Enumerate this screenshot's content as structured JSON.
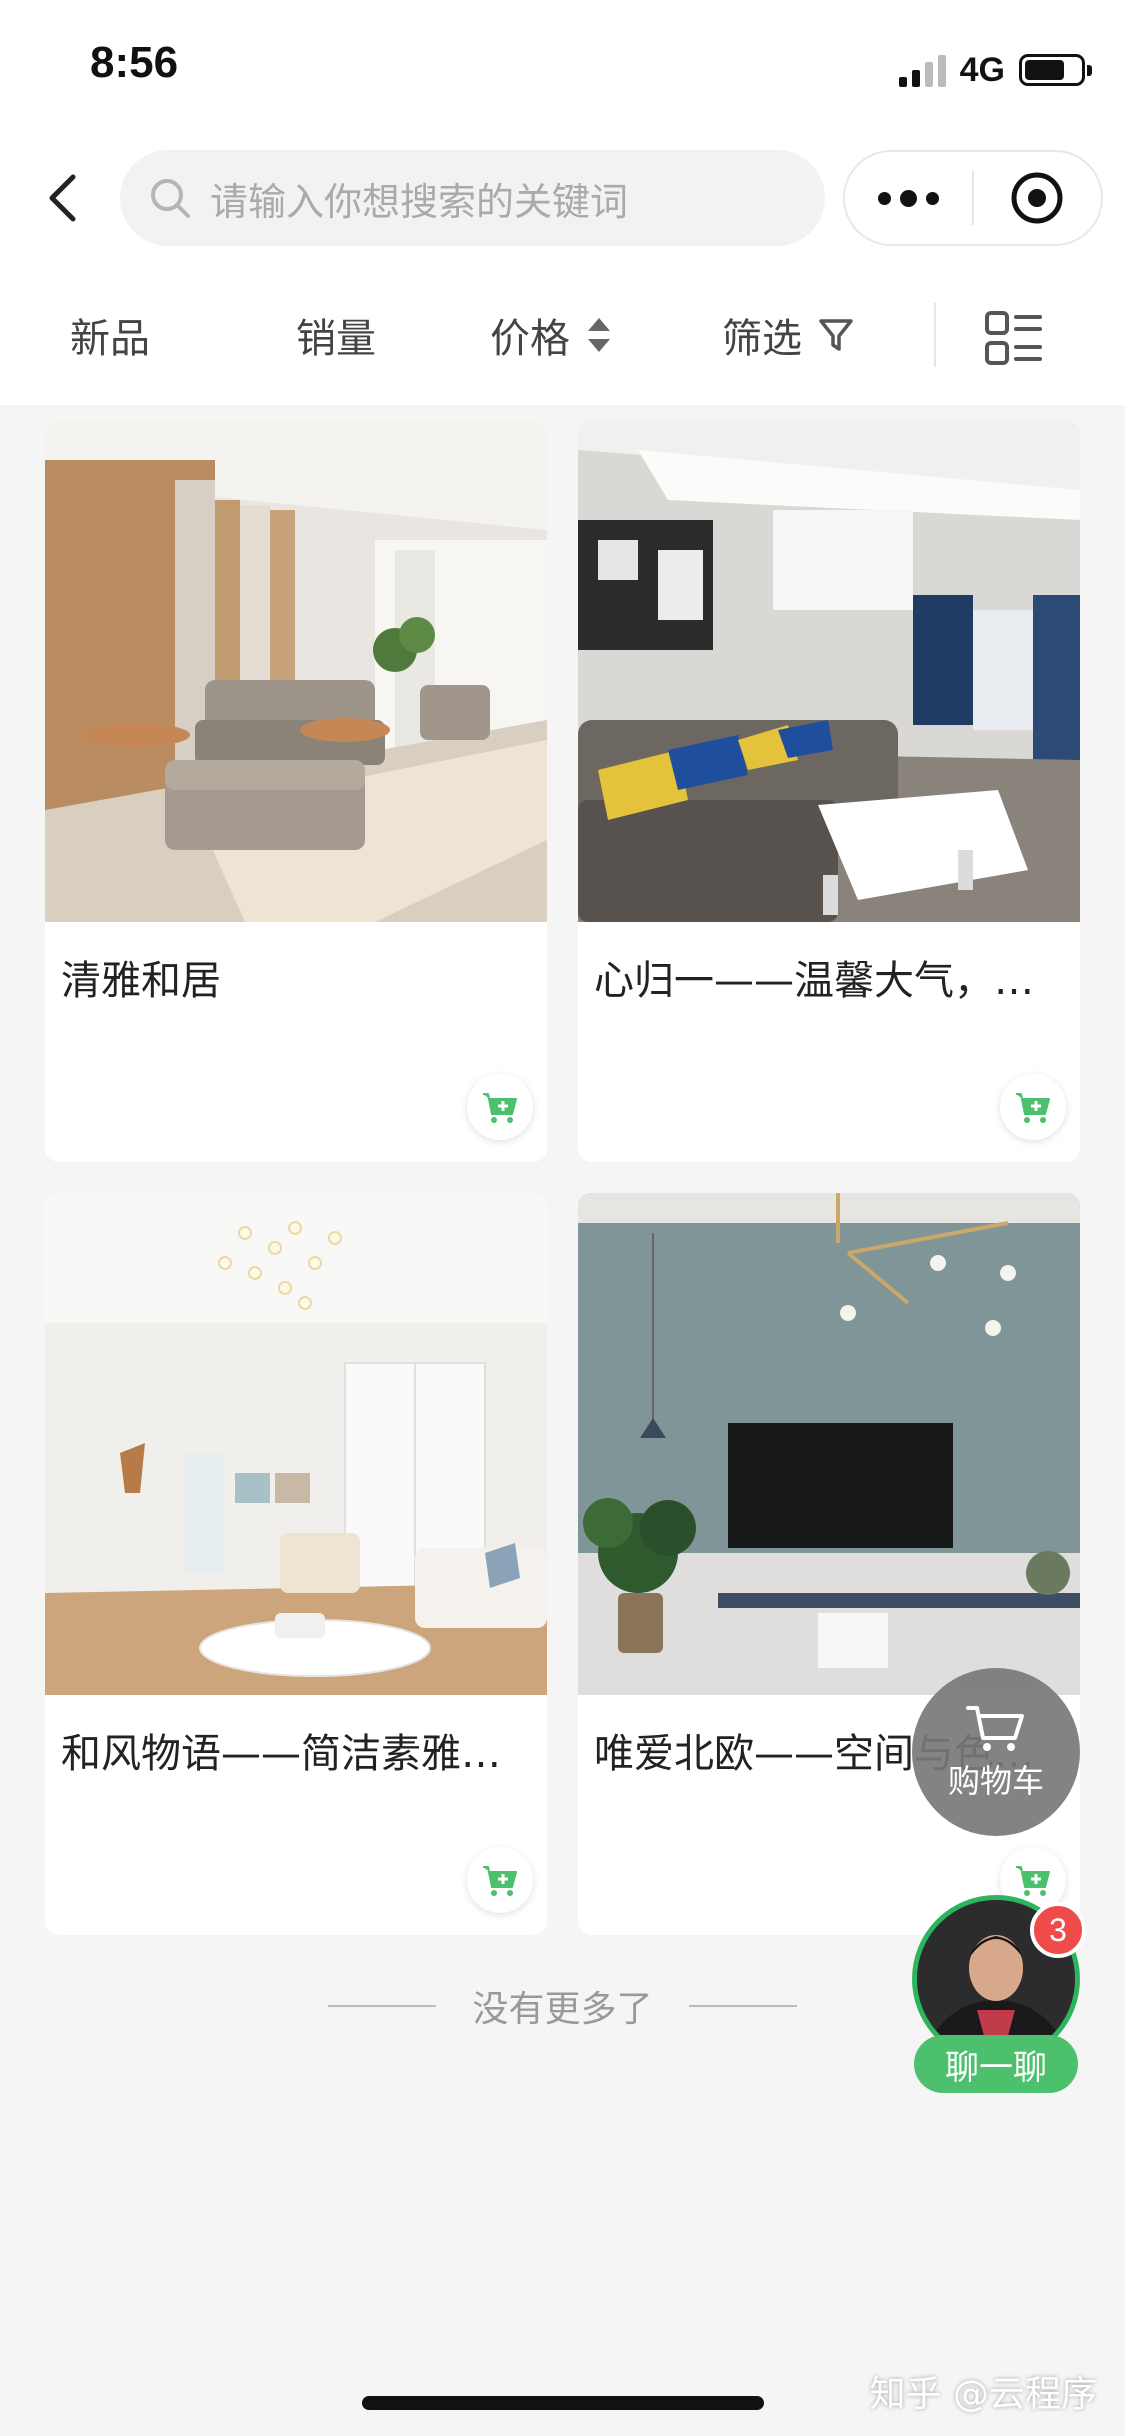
{
  "status_bar": {
    "time": "8:56",
    "network": "4G",
    "battery_level": 0.72
  },
  "search": {
    "placeholder": "请输入你想搜索的关键词"
  },
  "sort_bar": {
    "items": [
      "新品",
      "销量",
      "价格",
      "筛选"
    ]
  },
  "products": [
    {
      "title": "清雅和居"
    },
    {
      "title": "心归一——温馨大气，尽…"
    },
    {
      "title": "和风物语——简洁素雅，…"
    },
    {
      "title": "唯爱北欧——空间与色彩…"
    }
  ],
  "footer": {
    "no_more": "没有更多了"
  },
  "float_cart": {
    "label": "购物车"
  },
  "chat": {
    "badge": "3",
    "label": "聊一聊"
  },
  "watermark": "知乎 @云程序",
  "colors": {
    "accent_green": "#4cc06c",
    "badge_red": "#ef4b4b"
  }
}
